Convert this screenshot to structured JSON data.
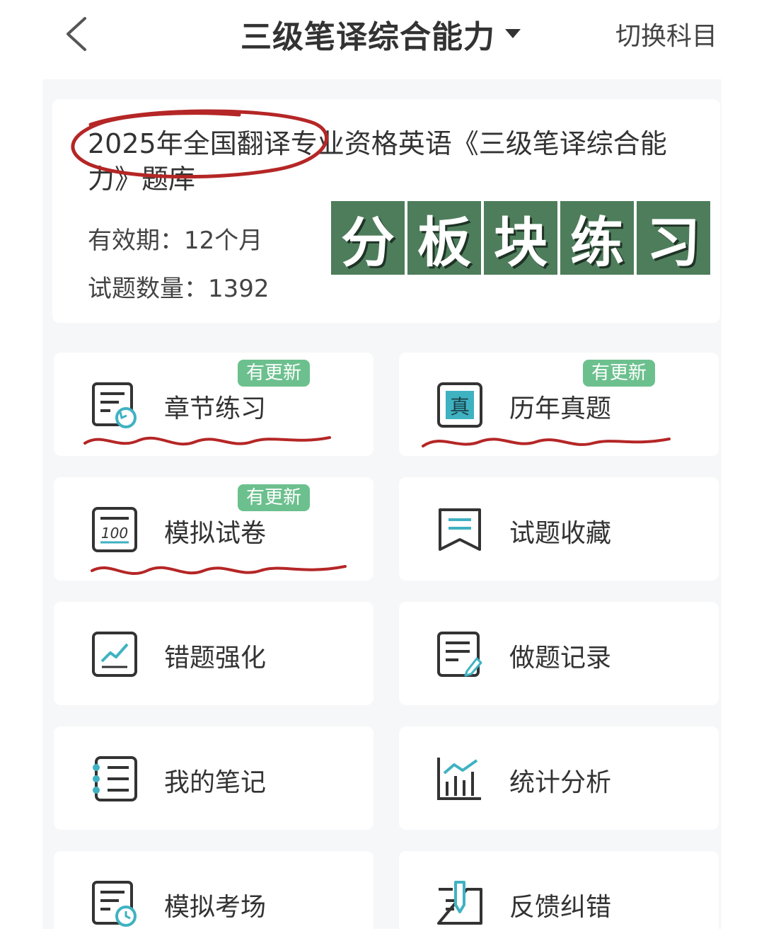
{
  "header": {
    "title": "三级笔译综合能力",
    "switch_label": "切换科目"
  },
  "bank": {
    "title": "2025年全国翻译专业资格英语《三级笔译综合能力》题库",
    "validity": "有效期：12个月",
    "question_count": "试题数量：1392"
  },
  "section_banner": [
    "分",
    "板",
    "块",
    "练",
    "习"
  ],
  "menu": [
    {
      "label": "章节练习",
      "badge": "有更新",
      "icon": "chapter-practice-icon"
    },
    {
      "label": "历年真题",
      "badge": "有更新",
      "icon": "past-papers-icon"
    },
    {
      "label": "模拟试卷",
      "badge": "有更新",
      "icon": "mock-paper-icon"
    },
    {
      "label": "试题收藏",
      "badge": "",
      "icon": "bookmark-icon"
    },
    {
      "label": "错题强化",
      "badge": "",
      "icon": "wrong-questions-icon"
    },
    {
      "label": "做题记录",
      "badge": "",
      "icon": "history-icon"
    },
    {
      "label": "我的笔记",
      "badge": "",
      "icon": "notebook-icon"
    },
    {
      "label": "统计分析",
      "badge": "",
      "icon": "statistics-icon"
    },
    {
      "label": "模拟考场",
      "badge": "",
      "icon": "mock-exam-icon"
    },
    {
      "label": "反馈纠错",
      "badge": "",
      "icon": "feedback-icon"
    }
  ],
  "colors": {
    "accent_teal": "#3fb2c2",
    "badge_green": "#6cc08e",
    "banner_green": "#4e7d5b",
    "annotation_red": "#b52626"
  }
}
